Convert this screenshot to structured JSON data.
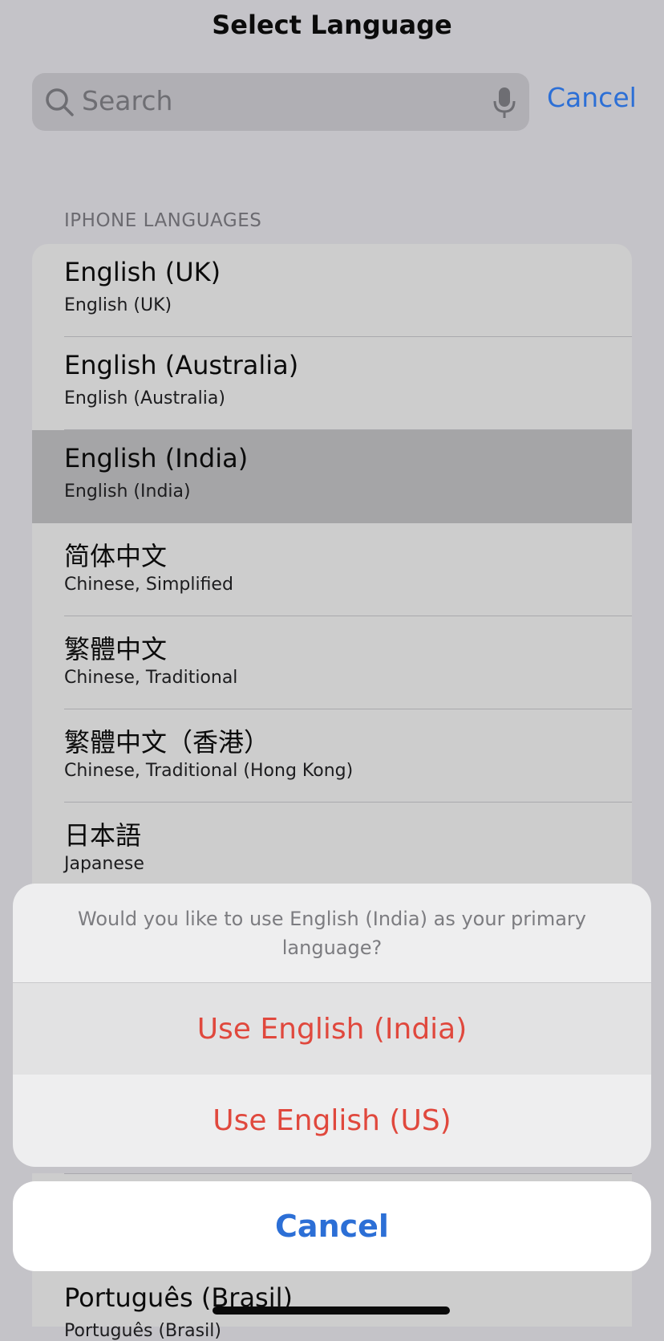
{
  "header": {
    "title": "Select Language"
  },
  "search": {
    "placeholder": "Search",
    "cancel_label": "Cancel"
  },
  "section": {
    "header": "IPHONE LANGUAGES"
  },
  "languages": [
    {
      "title": "English (UK)",
      "subtitle": "English (UK)"
    },
    {
      "title": "English (Australia)",
      "subtitle": "English (Australia)"
    },
    {
      "title": "English (India)",
      "subtitle": "English (India)",
      "selected": true
    },
    {
      "title": "简体中文",
      "subtitle": "Chinese, Simplified"
    },
    {
      "title": "繁體中文",
      "subtitle": "Chinese, Traditional"
    },
    {
      "title": "繁體中文（香港）",
      "subtitle": "Chinese, Traditional (Hong Kong)"
    },
    {
      "title": "日本語",
      "subtitle": "Japanese"
    },
    {
      "title": "Português (Brasil)",
      "subtitle": "Português (Brasil)"
    }
  ],
  "action_sheet": {
    "message": "Would you like to use English (India) as your primary language?",
    "primary_action": "Use English (India)",
    "secondary_action": "Use English (US)",
    "cancel_label": "Cancel"
  },
  "colors": {
    "accent_blue": "#2c6fd6",
    "destructive_red": "#e0483d"
  },
  "icons": {
    "search": "search-icon",
    "mic": "microphone-icon"
  }
}
